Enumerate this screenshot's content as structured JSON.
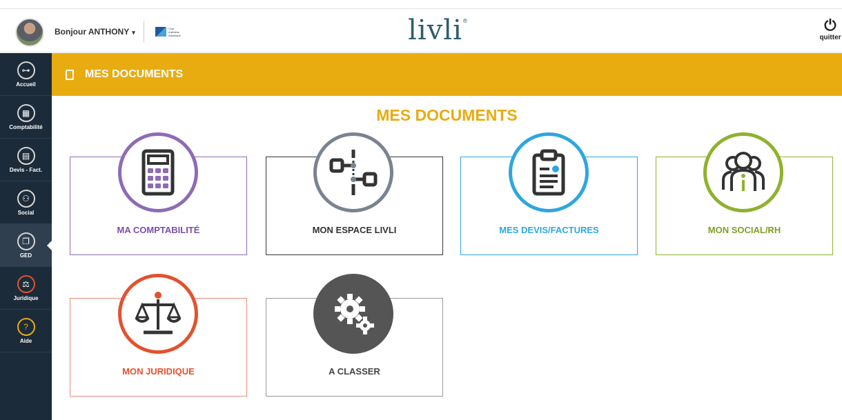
{
  "header": {
    "greeting": "Bonjour ANTHONY",
    "brand": "livli",
    "quit_label": "quitter",
    "icons": {
      "avatar": "user-avatar",
      "club_logo": "club-logo",
      "power": "power-icon"
    }
  },
  "sidebar": {
    "items": [
      {
        "label": "Accueil",
        "icon": "hub-icon",
        "active": false
      },
      {
        "label": "Comptabilité",
        "icon": "calculator-icon",
        "active": false
      },
      {
        "label": "Devis - Fact.",
        "icon": "clipboard-icon",
        "active": false
      },
      {
        "label": "Social",
        "icon": "people-icon",
        "active": false
      },
      {
        "label": "GED",
        "icon": "documents-icon",
        "active": true
      },
      {
        "label": "Juridique",
        "icon": "scales-icon",
        "active": false
      },
      {
        "label": "Aide",
        "icon": "help-icon",
        "active": false
      }
    ]
  },
  "banner": {
    "title": "MES DOCUMENTS",
    "icon": "documents-icon"
  },
  "main": {
    "title": "MES DOCUMENTS",
    "cards": [
      {
        "label": "MA COMPTABILITÉ",
        "color": "#8e6bb5",
        "icon": "calculator-icon"
      },
      {
        "label": "MON ESPACE LIVLI",
        "color": "#7a8390",
        "icon": "hub-icon"
      },
      {
        "label": "MES DEVIS/FACTURES",
        "color": "#2ea6df",
        "icon": "clipboard-icon"
      },
      {
        "label": "MON SOCIAL/RH",
        "color": "#8fb12d",
        "icon": "people-icon"
      },
      {
        "label": "MON JURIDIQUE",
        "color": "#e2522f",
        "icon": "scales-icon"
      },
      {
        "label": "A CLASSER",
        "color": "#555555",
        "icon": "gears-icon"
      }
    ]
  },
  "colors": {
    "accent": "#e8ac10",
    "sidebar": "#1c2b39",
    "brand": "#2f5d6c"
  }
}
